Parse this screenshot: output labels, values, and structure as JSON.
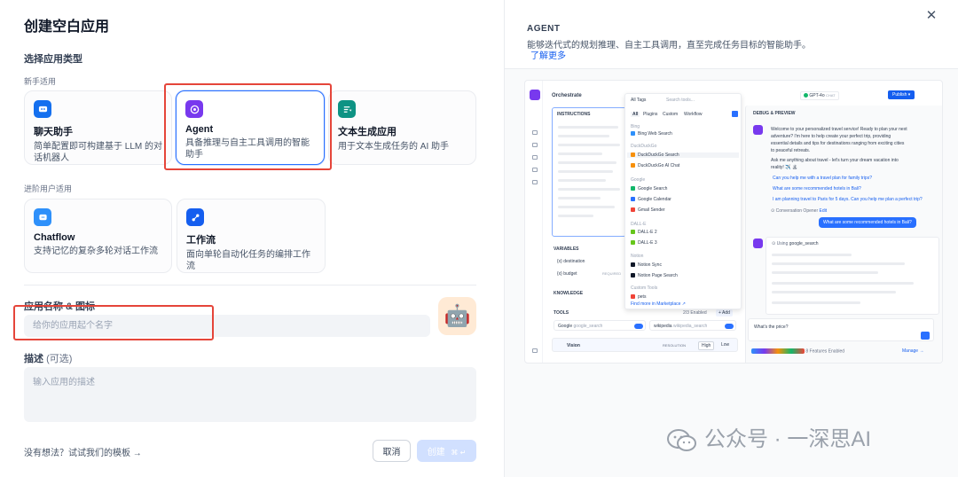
{
  "dialog": {
    "title": "创建空白应用",
    "type_section_label": "选择应用类型",
    "beginner_label": "新手适用",
    "advanced_label": "进阶用户适用",
    "name_section_label": "应用名称 & 图标",
    "name_placeholder": "给你的应用起个名字",
    "app_emoji": "🤖",
    "desc_section_label": "描述",
    "desc_optional": "(可选)",
    "desc_placeholder": "输入应用的描述",
    "template_prompt": "没有想法？试试我们的模板 →",
    "cancel_label": "取消",
    "create_label": "创建",
    "create_shortcut": "⌘ ↵"
  },
  "app_types": [
    {
      "name": "聊天助手",
      "desc": "简单配置即可构建基于 LLM 的对话机器人",
      "color": "#1570ef",
      "icon": "chat-bot-icon"
    },
    {
      "name": "Agent",
      "desc": "具备推理与自主工具调用的智能助手",
      "color": "#7839ee",
      "icon": "agent-icon"
    },
    {
      "name": "文本生成应用",
      "desc": "用于文本生成任务的 AI 助手",
      "color": "#0e9384",
      "icon": "text-generator-icon"
    },
    {
      "name": "Chatflow",
      "desc": "支持记忆的复杂多轮对话工作流",
      "color": "#2e90fa",
      "icon": "chatflow-icon"
    },
    {
      "name": "工作流",
      "desc": "面向单轮自动化任务的编排工作流",
      "color": "#155eef",
      "icon": "workflow-icon"
    }
  ],
  "preview_panel": {
    "title": "AGENT",
    "desc": "能够迭代式的规划推理、自主工具调用，直至完成任务目标的智能助手。",
    "learn_more": "了解更多",
    "close": "✕"
  },
  "preview": {
    "orchestrate": "Orchestrate",
    "instructions": "INSTRUCTIONS",
    "variables": "VARIABLES",
    "var1": "{x} destination",
    "var2": "{x} budget",
    "required": "REQUIRED",
    "knowledge": "KNOWLEDGE",
    "tools": "TOOLS",
    "tools_enabled": "2/3 Enabled",
    "add": "+ Add",
    "tool1": "Google",
    "tool1_sub": "google_search",
    "tool2": "wikipedia",
    "tool2_sub": "wikipedia_search",
    "vision": "Vision",
    "resolution": "RESOLUTION",
    "high": "High",
    "low": "Low",
    "all_tags": "All Tags",
    "search_tools": "Search tools...",
    "filter_all": "All",
    "filter_plugins": "Plugins",
    "filter_custom": "Custom",
    "filter_workflow": "Workflow",
    "grp_bing": "Bing",
    "bing_web": "Bing Web Search",
    "grp_ddg": "DuckDuckGo",
    "ddg_search": "DuckDuckGo Search",
    "ddg_chat": "DuckDuckGo AI Chat",
    "grp_google": "Google",
    "google_search": "Google Search",
    "google_calendar": "Google Calendar",
    "gmail": "Gmail Sender",
    "grp_dalle": "DALL-E",
    "dalle2": "DALL-E 2",
    "dalle3": "DALL-E 3",
    "grp_notion": "Notion",
    "notion_sync": "Notion Sync",
    "notion_page": "Notion Page Search",
    "grp_custom": "Custom Tools",
    "custom_item": "pets",
    "find_more": "Find more in",
    "marketplace": "Marketplace ↗",
    "model": "GPT-4o",
    "model_tag": "CHAT",
    "publish": "Publish ▾",
    "debug": "DEBUG & PREVIEW",
    "welcome1": "Welcome to your personalized travel service! Ready to plan your next",
    "welcome2": "adventure? I'm here to help create your perfect trip, providing",
    "welcome3": "essential details and tips for destinations ranging from exciting cities",
    "welcome4": "to peaceful retreats.",
    "ask1": "Ask me anything about travel - let's turn your dream vacation into",
    "ask2": "reality! ✈️ 🏝",
    "sugg1": "Can you help me with a travel plan for family trips?",
    "sugg2": "What are some recommended hotels in Bali?",
    "sugg3": "I am planning travel to Paris for 5 days. Can you help me plan a perfect trip?",
    "opener": "⊙ Conversation Opener",
    "edit": "Edit",
    "user_msg": "What are some recommended hotels in Bali?",
    "using": "⊙ Using",
    "using_tool": "google_search",
    "input_text": "What's the price?",
    "features": "8 Features Enabled",
    "manage": "Manage →"
  },
  "watermark": "公众号 · 一深思AI"
}
